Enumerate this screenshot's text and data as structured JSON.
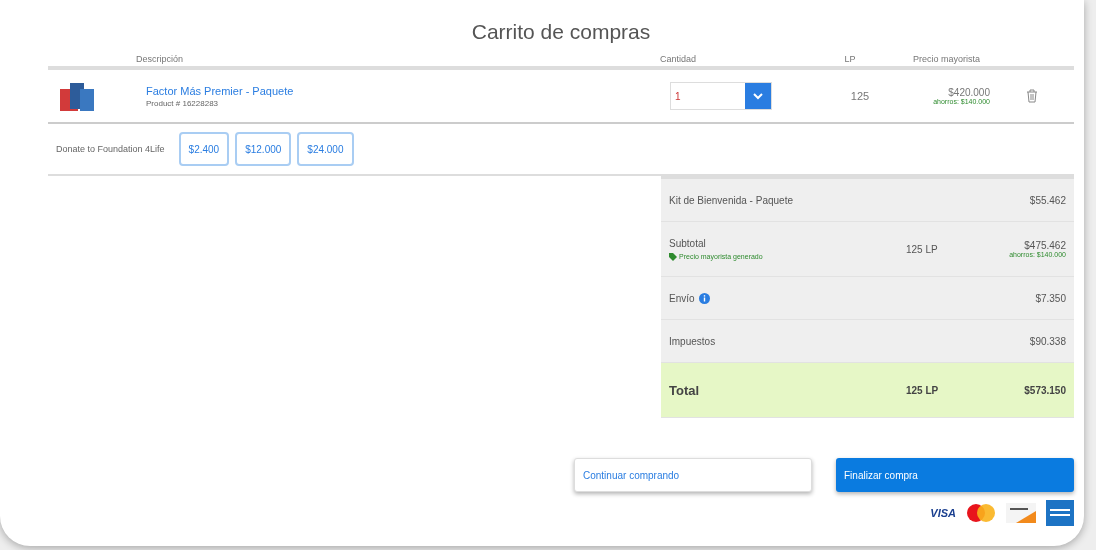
{
  "title": "Carrito de compras",
  "columns": [
    "Descripción",
    "Cantidad",
    "LP",
    "Precio mayorista"
  ],
  "items": [
    {
      "name": "Factor Más Premier - Paquete",
      "sku": "Product # 16228283",
      "quantity": "1",
      "lp": "125",
      "price": "$420.000",
      "savings": "ahorros: $140.000"
    }
  ],
  "donate": {
    "label": "Donate to Foundation 4Life",
    "amounts": [
      "$2.400",
      "$12.000",
      "$24.000"
    ]
  },
  "summary": [
    {
      "kind": "line",
      "label": "Kit de Bienvenida - Paquete",
      "value": "$55.462"
    },
    {
      "kind": "subtotal",
      "label": "Subtotal",
      "note": "Precio mayorista generado",
      "lp": "125 LP",
      "value": "$475.462",
      "savings": "ahorros: $140.000"
    },
    {
      "kind": "info",
      "label": "Envío",
      "value": "$7.350"
    },
    {
      "kind": "line",
      "label": "Impuestos",
      "value": "$90.338"
    },
    {
      "kind": "total",
      "label": "Total",
      "lp": "125 LP",
      "value": "$573.150"
    }
  ],
  "buttons": {
    "continue": "Continuar comprando",
    "checkout": "Finalizar compra"
  },
  "payment": {
    "visa": "VISA"
  }
}
